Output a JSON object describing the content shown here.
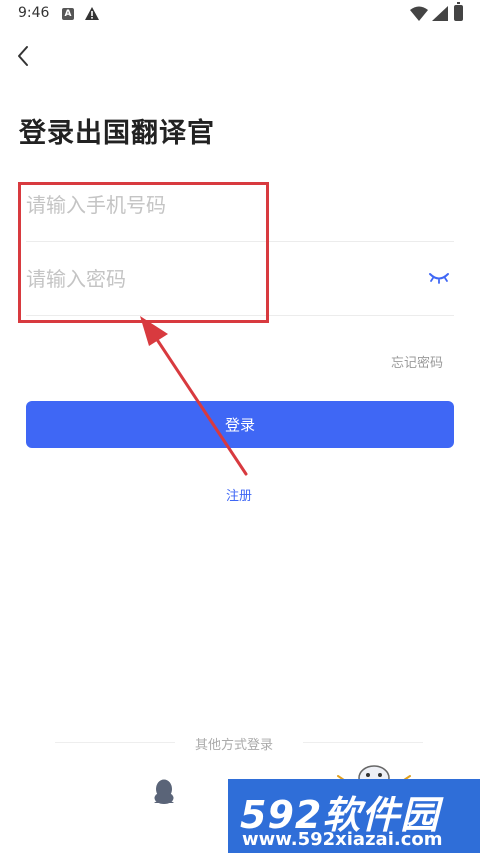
{
  "status_bar": {
    "time": "9:46",
    "notification_glyph": "A",
    "icons": [
      "a-notification-icon",
      "warning-icon",
      "wifi-icon",
      "signal-icon",
      "battery-icon"
    ]
  },
  "nav": {
    "back_icon": "chevron-left-icon"
  },
  "page": {
    "title": "登录出国翻译官"
  },
  "form": {
    "phone_placeholder": "请输入手机号码",
    "phone_value": "",
    "password_placeholder": "请输入密码",
    "password_value": "",
    "eye_icon": "eye-closed-icon",
    "forgot_password": "忘记密码",
    "login_button": "登录",
    "register_link": "注册"
  },
  "other_login": {
    "label": "其他方式登录",
    "methods": [
      "qq-icon"
    ]
  },
  "watermark": {
    "logo": "592软件园",
    "url": "www.592xiazai.com"
  },
  "colors": {
    "primary": "#3f67f5",
    "annotation": "#d83a3f",
    "placeholder": "#c4c4c4",
    "muted": "#9a9a9a",
    "watermark_band": "#2f6ed8"
  }
}
